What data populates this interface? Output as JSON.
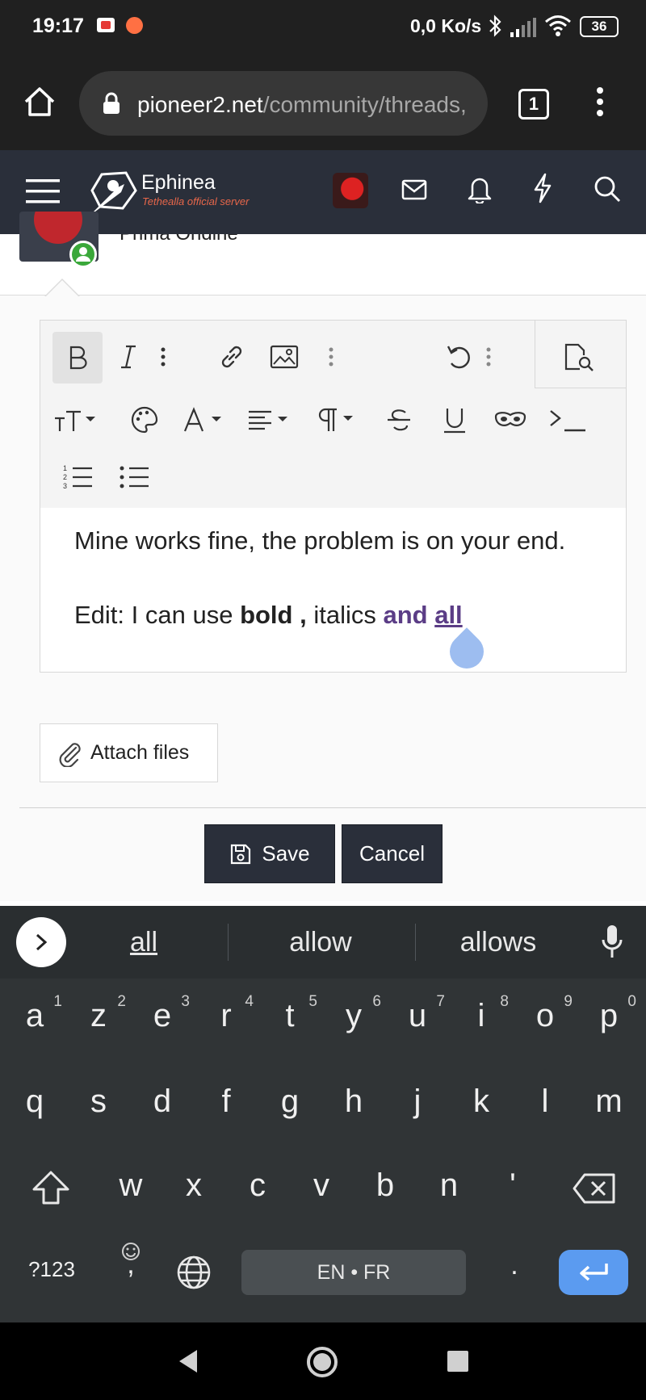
{
  "status_bar": {
    "time": "19:17",
    "net_speed": "0,0 Ko/s",
    "battery": "36"
  },
  "browser": {
    "url_host": "pioneer2.net",
    "url_path": "/community/threads,",
    "tab_count": "1"
  },
  "site": {
    "brand": "Ephinea",
    "tagline": "Tethealla official server"
  },
  "post": {
    "author": "Prima Ondine"
  },
  "editor": {
    "line1": "Mine works fine, the problem is on your end.",
    "line2_prefix": "Edit: I can use ",
    "line2_bold": "bold",
    "line2_comma": " , ",
    "line2_italic": "italics ",
    "line2_and": "and ",
    "line2_all": "all"
  },
  "actions": {
    "attach": "Attach files",
    "save": "Save",
    "cancel": "Cancel"
  },
  "keyboard": {
    "suggestions": [
      "all",
      "allow",
      "allows"
    ],
    "row1": [
      "a",
      "z",
      "e",
      "r",
      "t",
      "y",
      "u",
      "i",
      "o",
      "p"
    ],
    "row1_nums": [
      "1",
      "2",
      "3",
      "4",
      "5",
      "6",
      "7",
      "8",
      "9",
      "0"
    ],
    "row2": [
      "q",
      "s",
      "d",
      "f",
      "g",
      "h",
      "j",
      "k",
      "l",
      "m"
    ],
    "row3": [
      "w",
      "x",
      "c",
      "v",
      "b",
      "n",
      "'"
    ],
    "symbols_key": "?123",
    "comma_key": ",",
    "space_label": "EN • FR",
    "period_key": "."
  },
  "colors": {
    "site_header": "#2a2f3a",
    "accent_purple": "#5b3d86",
    "enter_key": "#5b9bf0",
    "tagline": "#e8674a"
  }
}
